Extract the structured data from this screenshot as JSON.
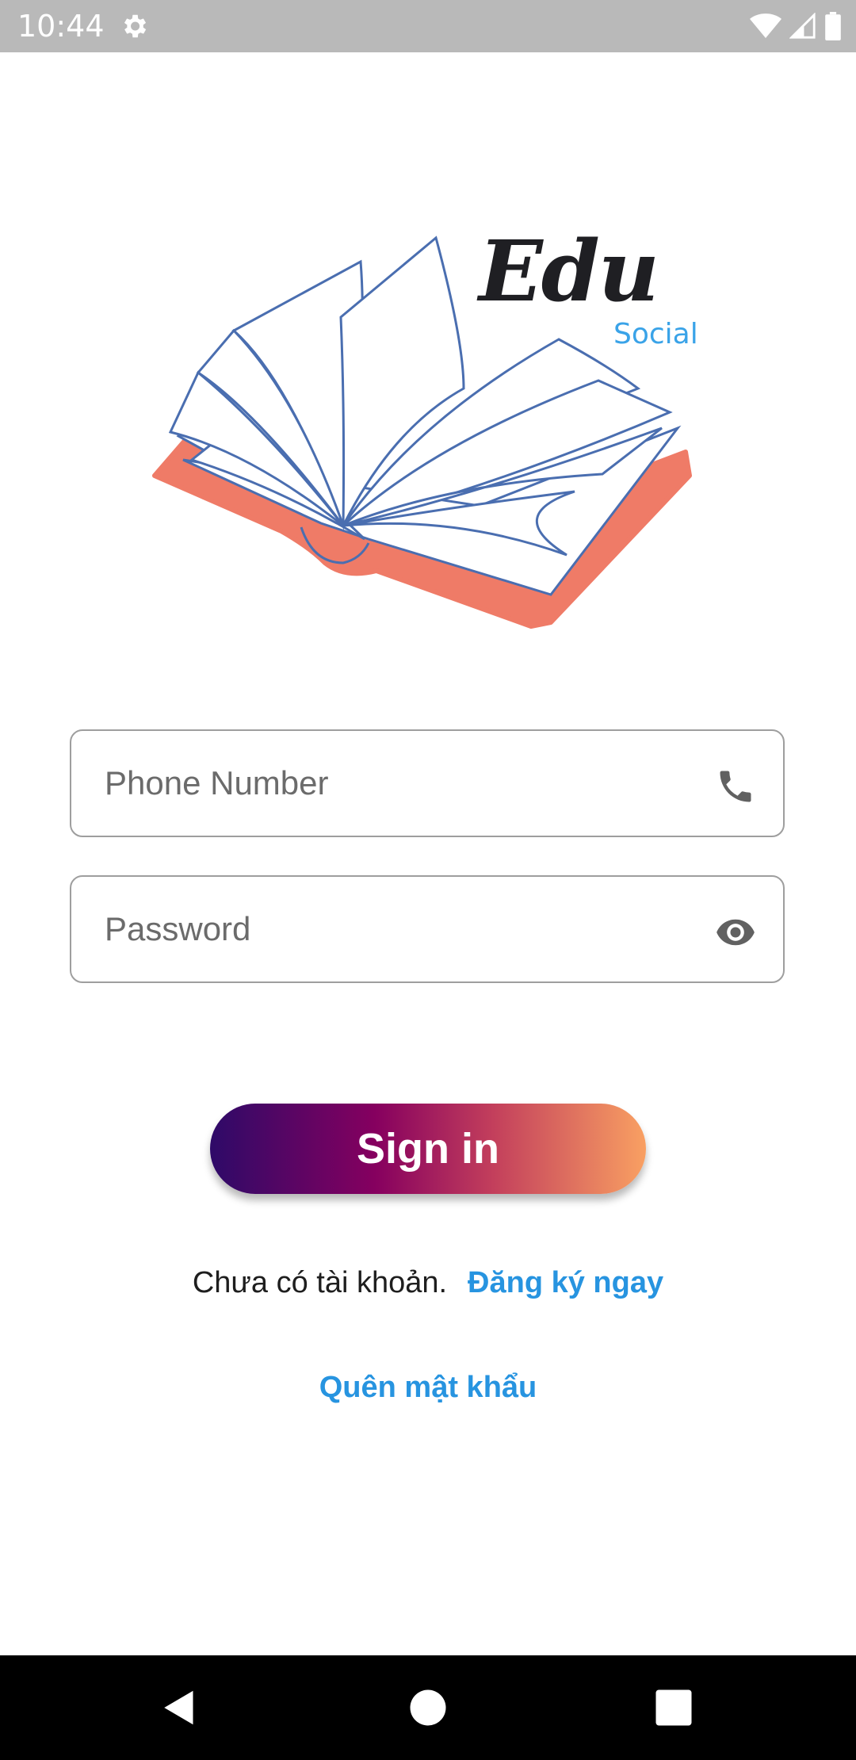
{
  "status_bar": {
    "time": "10:44",
    "icons": [
      "settings-icon",
      "wifi-icon",
      "signal-icon",
      "battery-icon"
    ]
  },
  "logo": {
    "title": "Edu",
    "subtitle": "Social",
    "colors": {
      "book_cover": "#ef7b67",
      "page_lines": "#4a6eb0",
      "title": "#1f1f23",
      "subtitle": "#3aa3e8"
    }
  },
  "form": {
    "phone": {
      "placeholder": "Phone Number",
      "value": "",
      "icon": "phone-icon"
    },
    "password": {
      "placeholder": "Password",
      "value": "",
      "icon": "eye-icon"
    },
    "sign_in_label": "Sign in"
  },
  "register": {
    "prompt": "Chưa có tài khoản.",
    "link": "Đăng ký ngay"
  },
  "forgot_password": "Quên mật khẩu",
  "nav_bar": {
    "buttons": [
      "back-icon",
      "home-icon",
      "recents-icon"
    ]
  },
  "colors": {
    "link": "#2794e0",
    "button_gradient": [
      "#2e0a68",
      "#86005f",
      "#c33f5c",
      "#f9a062"
    ],
    "status_bar": "#b9b9b9",
    "nav_bar": "#000000"
  }
}
